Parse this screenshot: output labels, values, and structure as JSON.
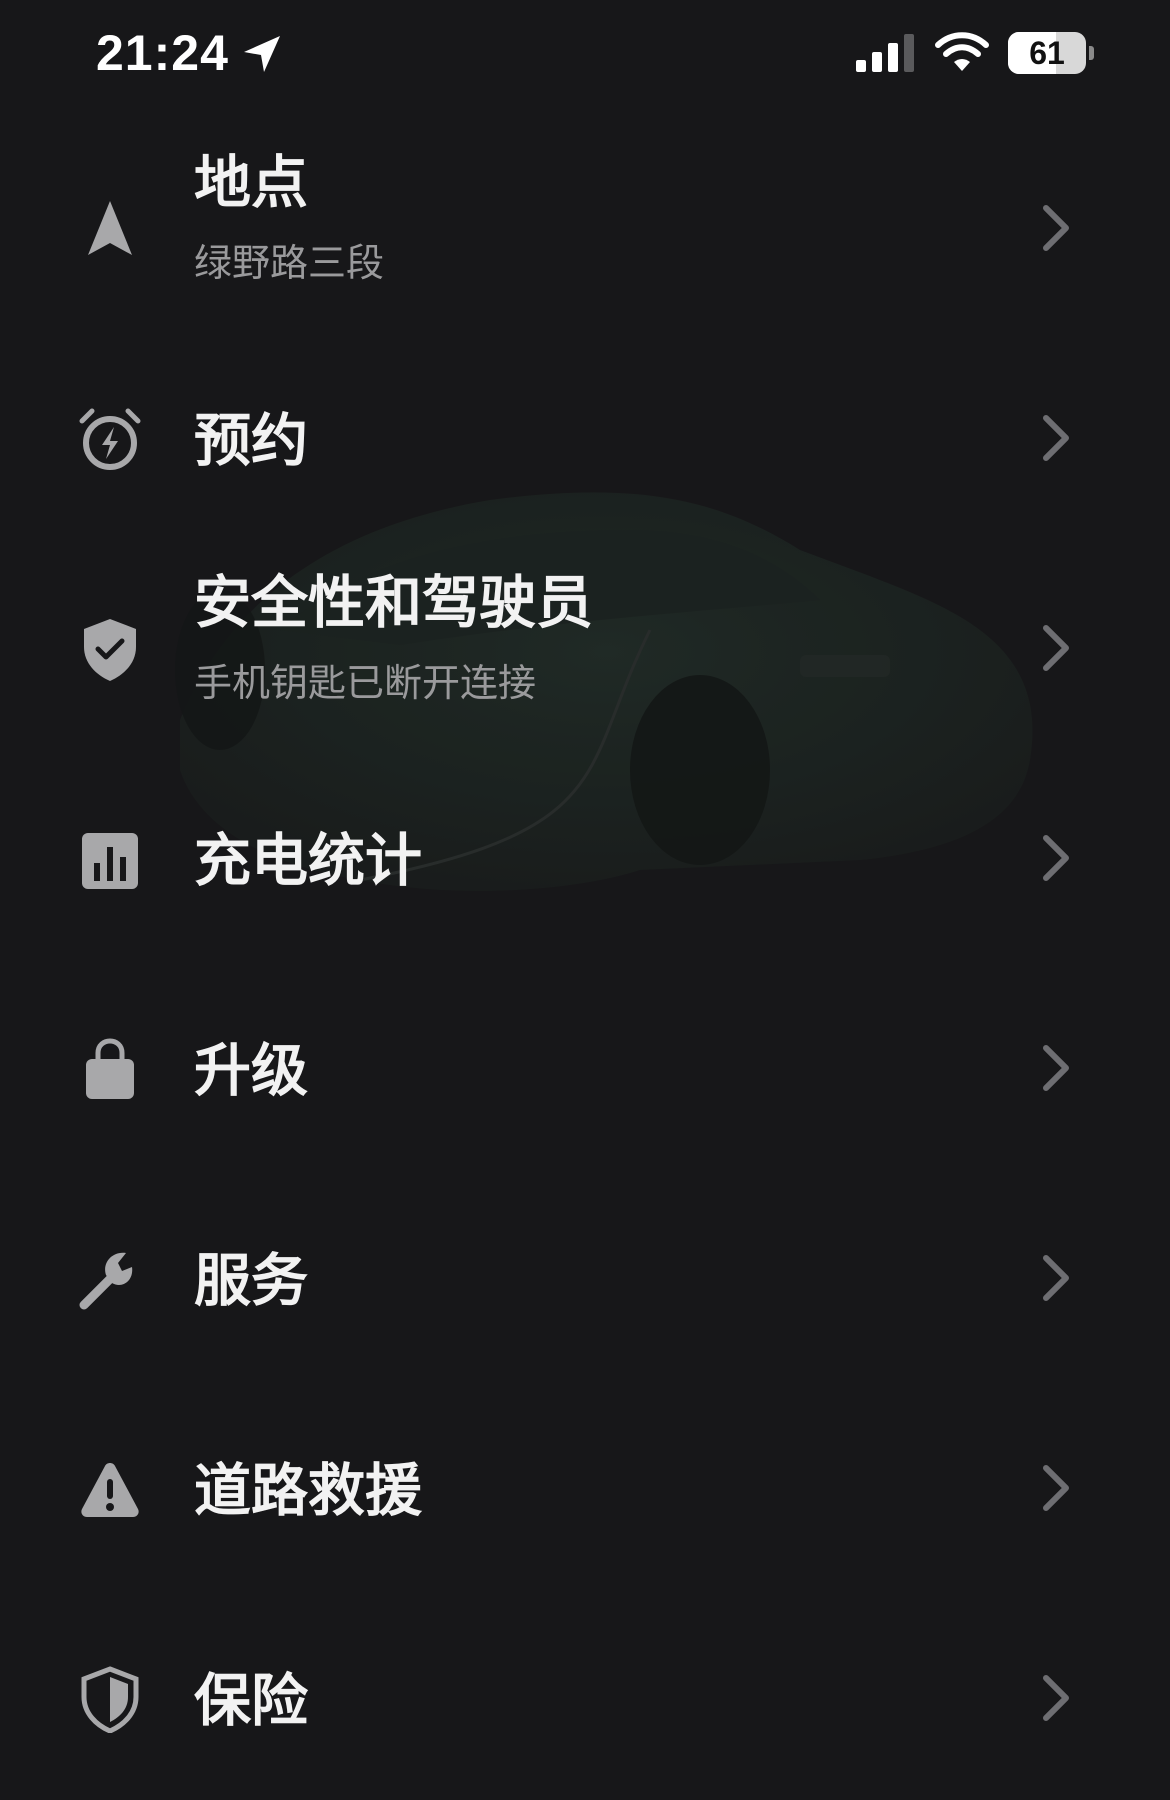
{
  "status_bar": {
    "time": "21:24",
    "battery_percent": "61",
    "battery_level": 0.61,
    "location_icon": "location-arrow-icon",
    "signal_icon": "cellular-signal-icon",
    "wifi_icon": "wifi-icon"
  },
  "menu": {
    "items": [
      {
        "id": "location",
        "title": "地点",
        "subtitle": "绿野路三段",
        "icon": "navigation-arrow-icon"
      },
      {
        "id": "schedule",
        "title": "预约",
        "icon": "alarm-clock-bolt-icon"
      },
      {
        "id": "safety",
        "title": "安全性和驾驶员",
        "subtitle": "手机钥匙已断开连接",
        "icon": "shield-check-icon"
      },
      {
        "id": "charging-stats",
        "title": "充电统计",
        "icon": "bar-chart-icon"
      },
      {
        "id": "upgrades",
        "title": "升级",
        "icon": "shopping-bag-icon"
      },
      {
        "id": "service",
        "title": "服务",
        "icon": "wrench-icon"
      },
      {
        "id": "roadside",
        "title": "道路救援",
        "icon": "warning-triangle-icon"
      },
      {
        "id": "insurance",
        "title": "保险",
        "icon": "shield-icon"
      }
    ]
  },
  "colors": {
    "background": "#171719",
    "title": "#f2f2f2",
    "subtitle": "#9a9a9c",
    "icon": "#a8a8aa",
    "chevron": "#6e6e72"
  }
}
